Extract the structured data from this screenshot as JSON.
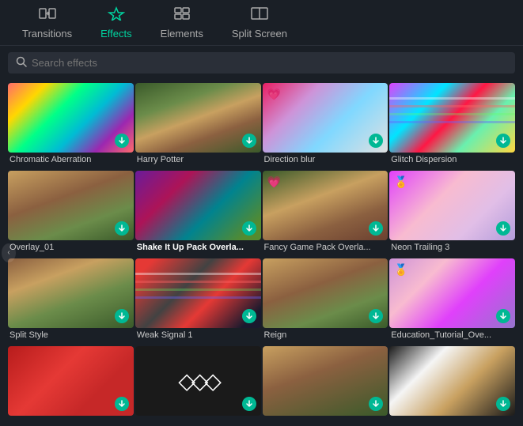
{
  "nav": {
    "items": [
      {
        "id": "transitions",
        "label": "Transitions",
        "icon": "⇄",
        "active": false
      },
      {
        "id": "effects",
        "label": "Effects",
        "icon": "✦",
        "active": true
      },
      {
        "id": "elements",
        "label": "Elements",
        "icon": "⊞",
        "active": false
      },
      {
        "id": "split-screen",
        "label": "Split Screen",
        "icon": "⊡",
        "active": false
      }
    ]
  },
  "search": {
    "placeholder": "Search effects"
  },
  "effects": [
    {
      "id": "chromatic-aberration",
      "label": "Chromatic Aberration",
      "thumb_class": "thumb-chromatic",
      "premium": false,
      "download": true,
      "bold": false
    },
    {
      "id": "harry-potter",
      "label": "Harry Potter",
      "thumb_class": "thumb-harry-potter",
      "premium": false,
      "download": true,
      "bold": false
    },
    {
      "id": "direction-blur",
      "label": "Direction blur",
      "thumb_class": "thumb-direction-blur",
      "premium": true,
      "premium_icon": "💗",
      "download": true,
      "bold": false
    },
    {
      "id": "glitch-dispersion",
      "label": "Glitch Dispersion",
      "thumb_class": "thumb-glitch",
      "premium": false,
      "download": true,
      "bold": false
    },
    {
      "id": "overlay-01",
      "label": "Overlay_01",
      "thumb_class": "thumb-overlay01",
      "premium": false,
      "download": true,
      "bold": false
    },
    {
      "id": "shake-it-up",
      "label": "Shake It Up Pack Overla...",
      "thumb_class": "thumb-shake",
      "premium": false,
      "download": true,
      "bold": true
    },
    {
      "id": "fancy-game",
      "label": "Fancy Game Pack Overla...",
      "thumb_class": "thumb-fancy-game",
      "premium": true,
      "premium_icon": "💗",
      "download": true,
      "bold": false
    },
    {
      "id": "neon-trailing-3",
      "label": "Neon Trailing 3",
      "thumb_class": "thumb-neon-trailing",
      "premium": true,
      "premium_icon": "🏅",
      "download": true,
      "bold": false
    },
    {
      "id": "split-style",
      "label": "Split Style",
      "thumb_class": "thumb-split-style",
      "premium": false,
      "download": true,
      "bold": false
    },
    {
      "id": "weak-signal-1",
      "label": "Weak Signal 1",
      "thumb_class": "thumb-weak-signal",
      "premium": false,
      "download": true,
      "bold": false
    },
    {
      "id": "reign",
      "label": "Reign",
      "thumb_class": "thumb-reign",
      "premium": false,
      "download": true,
      "bold": false
    },
    {
      "id": "education-tutorial",
      "label": "Education_Tutorial_Ove...",
      "thumb_class": "thumb-education",
      "premium": true,
      "premium_icon": "🏅",
      "download": true,
      "bold": false
    },
    {
      "id": "row4-1",
      "label": "",
      "thumb_class": "thumb-row4-1",
      "premium": false,
      "download": true,
      "bold": false
    },
    {
      "id": "row4-2",
      "label": "",
      "thumb_class": "thumb-row4-2 diamond-pattern",
      "premium": false,
      "download": true,
      "bold": false
    },
    {
      "id": "row4-3",
      "label": "",
      "thumb_class": "thumb-row4-3",
      "premium": false,
      "download": true,
      "bold": false
    },
    {
      "id": "row4-4",
      "label": "",
      "thumb_class": "thumb-row4-4",
      "premium": false,
      "download": true,
      "bold": false
    }
  ]
}
